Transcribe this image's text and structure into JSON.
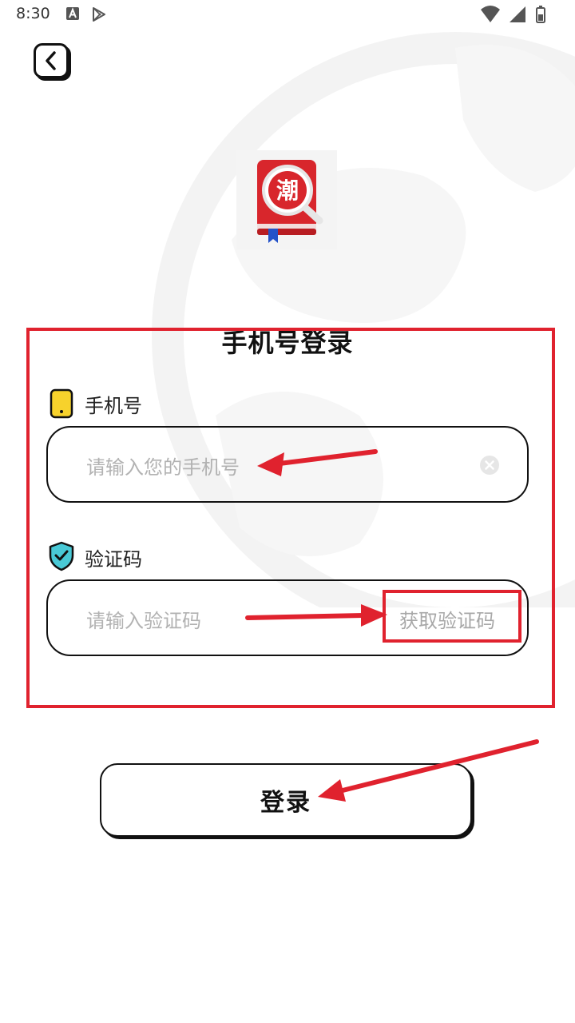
{
  "status_bar": {
    "time": "8:30",
    "left_icons": [
      "a-notification-icon",
      "play-store-icon"
    ],
    "right_icons": [
      "wifi-icon",
      "signal-icon",
      "battery-icon"
    ]
  },
  "header": {
    "back_icon": "chevron-left-icon"
  },
  "logo": {
    "glyph": "潮",
    "icon": "red-book-magnifier-logo"
  },
  "form": {
    "title": "手机号登录",
    "phone": {
      "label": "手机号",
      "icon": "phone-icon",
      "placeholder": "请输入您的手机号",
      "clear_icon": "clear-circle-icon"
    },
    "code": {
      "label": "验证码",
      "icon": "shield-check-icon",
      "placeholder": "请输入验证码",
      "get_code_label": "获取验证码"
    }
  },
  "login_button": {
    "label": "登录"
  },
  "colors": {
    "annotation": "#e0222e",
    "phone_icon_fill": "#f7d22c",
    "shield_fill": "#49c9d6",
    "placeholder": "#b2b2b2",
    "logo_red": "#d8262c"
  }
}
